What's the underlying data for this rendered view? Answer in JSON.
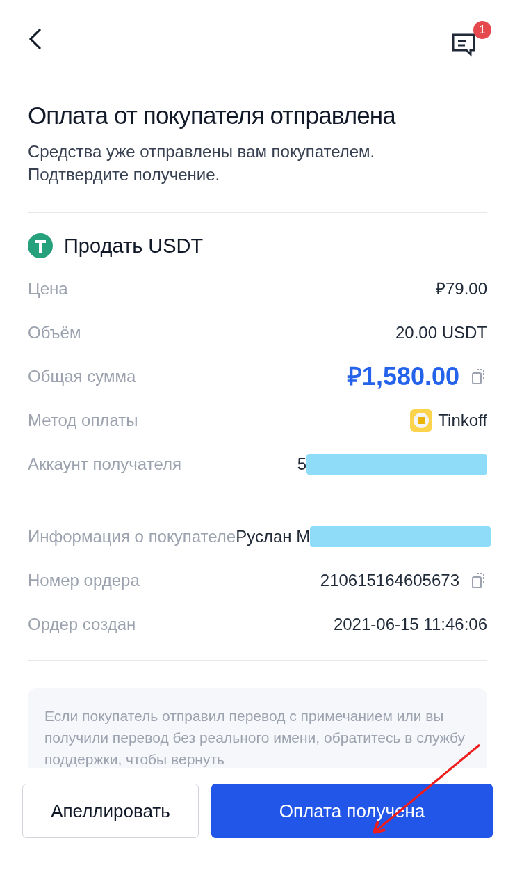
{
  "header": {
    "badge": "1"
  },
  "title": "Оплата от покупателя отправлена",
  "subtitle": "Средства уже отправлены вам покупателем. Подтвердите получение.",
  "trade": {
    "label": "Продать USDT"
  },
  "details": [
    {
      "kind": "text",
      "label": "Цена",
      "value": "₽79.00"
    },
    {
      "kind": "text",
      "label": "Объём",
      "value": "20.00 USDT"
    },
    {
      "kind": "amount",
      "label": "Общая сумма",
      "value": "₽1,580.00"
    },
    {
      "kind": "method",
      "label": "Метод оплаты",
      "value": "Tinkoff"
    },
    {
      "kind": "redacted",
      "label": "Аккаунт получателя",
      "value": "5"
    }
  ],
  "order": [
    {
      "kind": "redacted",
      "label": "Информация о покупателе",
      "value": "Руслан М"
    },
    {
      "kind": "copy",
      "label": "Номер ордера",
      "value": "210615164605673"
    },
    {
      "kind": "text",
      "label": "Ордер создан",
      "value": "2021-06-15 11:46:06"
    }
  ],
  "notice": "Если покупатель отправил перевод с примечанием или вы получили перевод без реального имени, обратитесь в службу поддержки, чтобы вернуть",
  "buttons": {
    "appeal": "Апеллировать",
    "confirm": "Оплата получена"
  }
}
